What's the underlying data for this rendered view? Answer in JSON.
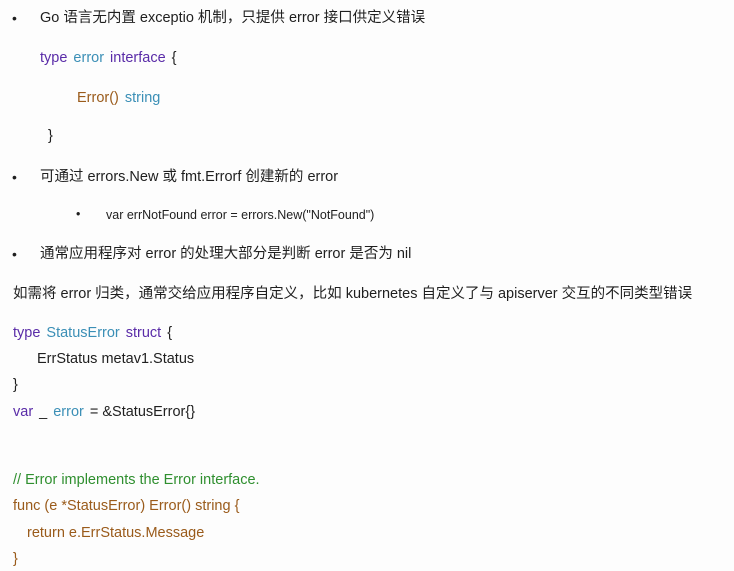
{
  "bullets": {
    "b1": "Go 语言无内置 exceptio 机制，只提供 error 接口供定义错误",
    "b2": "可通过 errors.New 或 fmt.Errorf 创建新的 error",
    "b2_sub": "var errNotFound error = errors.New(\"NotFound\")",
    "b3": "通常应用程序对 error 的处理大部分是判断 error 是否为 nil"
  },
  "bullet_glyph": "•",
  "interface_code": {
    "kw_type": "type",
    "name": "error",
    "kw_interface": "interface",
    "open": "{",
    "method": "Error()",
    "return_type": "string",
    "close": "}"
  },
  "paragraph": "如需将 error 归类，通常交给应用程序自定义，比如 kubernetes 自定义了与 apiserver 交互的不同类型错误",
  "struct_code": {
    "kw_type": "type",
    "name": "StatusError",
    "kw_struct": "struct",
    "open": "{",
    "field": "ErrStatus metav1.Status",
    "close": "}",
    "var_kw": "var",
    "var_blank": "_",
    "var_type": "error",
    "var_rest": "= &StatusError{}"
  },
  "method_code": {
    "comment": "// Error implements the Error interface.",
    "signature": "func (e *StatusError) Error() string {",
    "return_line": "return e.ErrStatus.Message",
    "close": "}"
  },
  "colors": {
    "keyword": "#5a2ca8",
    "type": "#3b8fb6",
    "func": "#9a5b1b",
    "comment": "#2f8f2f"
  }
}
